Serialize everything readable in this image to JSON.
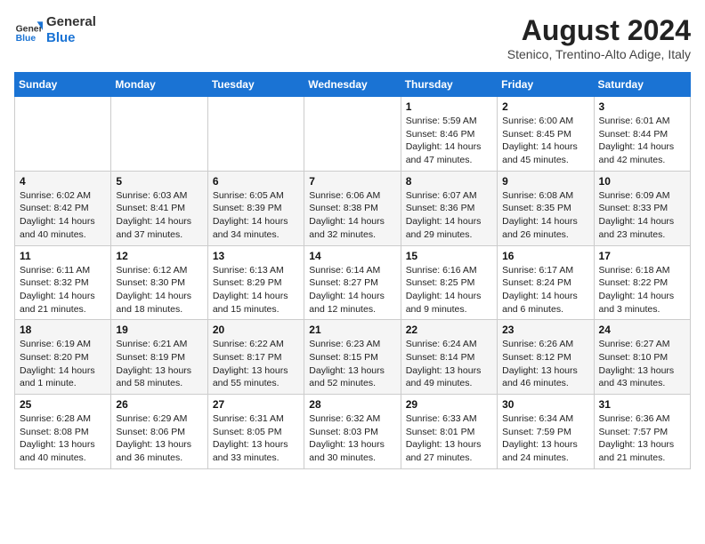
{
  "header": {
    "logo_general": "General",
    "logo_blue": "Blue",
    "month_year": "August 2024",
    "location": "Stenico, Trentino-Alto Adige, Italy"
  },
  "weekdays": [
    "Sunday",
    "Monday",
    "Tuesday",
    "Wednesday",
    "Thursday",
    "Friday",
    "Saturday"
  ],
  "weeks": [
    [
      {
        "day": "",
        "info": ""
      },
      {
        "day": "",
        "info": ""
      },
      {
        "day": "",
        "info": ""
      },
      {
        "day": "",
        "info": ""
      },
      {
        "day": "1",
        "info": "Sunrise: 5:59 AM\nSunset: 8:46 PM\nDaylight: 14 hours and 47 minutes."
      },
      {
        "day": "2",
        "info": "Sunrise: 6:00 AM\nSunset: 8:45 PM\nDaylight: 14 hours and 45 minutes."
      },
      {
        "day": "3",
        "info": "Sunrise: 6:01 AM\nSunset: 8:44 PM\nDaylight: 14 hours and 42 minutes."
      }
    ],
    [
      {
        "day": "4",
        "info": "Sunrise: 6:02 AM\nSunset: 8:42 PM\nDaylight: 14 hours and 40 minutes."
      },
      {
        "day": "5",
        "info": "Sunrise: 6:03 AM\nSunset: 8:41 PM\nDaylight: 14 hours and 37 minutes."
      },
      {
        "day": "6",
        "info": "Sunrise: 6:05 AM\nSunset: 8:39 PM\nDaylight: 14 hours and 34 minutes."
      },
      {
        "day": "7",
        "info": "Sunrise: 6:06 AM\nSunset: 8:38 PM\nDaylight: 14 hours and 32 minutes."
      },
      {
        "day": "8",
        "info": "Sunrise: 6:07 AM\nSunset: 8:36 PM\nDaylight: 14 hours and 29 minutes."
      },
      {
        "day": "9",
        "info": "Sunrise: 6:08 AM\nSunset: 8:35 PM\nDaylight: 14 hours and 26 minutes."
      },
      {
        "day": "10",
        "info": "Sunrise: 6:09 AM\nSunset: 8:33 PM\nDaylight: 14 hours and 23 minutes."
      }
    ],
    [
      {
        "day": "11",
        "info": "Sunrise: 6:11 AM\nSunset: 8:32 PM\nDaylight: 14 hours and 21 minutes."
      },
      {
        "day": "12",
        "info": "Sunrise: 6:12 AM\nSunset: 8:30 PM\nDaylight: 14 hours and 18 minutes."
      },
      {
        "day": "13",
        "info": "Sunrise: 6:13 AM\nSunset: 8:29 PM\nDaylight: 14 hours and 15 minutes."
      },
      {
        "day": "14",
        "info": "Sunrise: 6:14 AM\nSunset: 8:27 PM\nDaylight: 14 hours and 12 minutes."
      },
      {
        "day": "15",
        "info": "Sunrise: 6:16 AM\nSunset: 8:25 PM\nDaylight: 14 hours and 9 minutes."
      },
      {
        "day": "16",
        "info": "Sunrise: 6:17 AM\nSunset: 8:24 PM\nDaylight: 14 hours and 6 minutes."
      },
      {
        "day": "17",
        "info": "Sunrise: 6:18 AM\nSunset: 8:22 PM\nDaylight: 14 hours and 3 minutes."
      }
    ],
    [
      {
        "day": "18",
        "info": "Sunrise: 6:19 AM\nSunset: 8:20 PM\nDaylight: 14 hours and 1 minute."
      },
      {
        "day": "19",
        "info": "Sunrise: 6:21 AM\nSunset: 8:19 PM\nDaylight: 13 hours and 58 minutes."
      },
      {
        "day": "20",
        "info": "Sunrise: 6:22 AM\nSunset: 8:17 PM\nDaylight: 13 hours and 55 minutes."
      },
      {
        "day": "21",
        "info": "Sunrise: 6:23 AM\nSunset: 8:15 PM\nDaylight: 13 hours and 52 minutes."
      },
      {
        "day": "22",
        "info": "Sunrise: 6:24 AM\nSunset: 8:14 PM\nDaylight: 13 hours and 49 minutes."
      },
      {
        "day": "23",
        "info": "Sunrise: 6:26 AM\nSunset: 8:12 PM\nDaylight: 13 hours and 46 minutes."
      },
      {
        "day": "24",
        "info": "Sunrise: 6:27 AM\nSunset: 8:10 PM\nDaylight: 13 hours and 43 minutes."
      }
    ],
    [
      {
        "day": "25",
        "info": "Sunrise: 6:28 AM\nSunset: 8:08 PM\nDaylight: 13 hours and 40 minutes."
      },
      {
        "day": "26",
        "info": "Sunrise: 6:29 AM\nSunset: 8:06 PM\nDaylight: 13 hours and 36 minutes."
      },
      {
        "day": "27",
        "info": "Sunrise: 6:31 AM\nSunset: 8:05 PM\nDaylight: 13 hours and 33 minutes."
      },
      {
        "day": "28",
        "info": "Sunrise: 6:32 AM\nSunset: 8:03 PM\nDaylight: 13 hours and 30 minutes."
      },
      {
        "day": "29",
        "info": "Sunrise: 6:33 AM\nSunset: 8:01 PM\nDaylight: 13 hours and 27 minutes."
      },
      {
        "day": "30",
        "info": "Sunrise: 6:34 AM\nSunset: 7:59 PM\nDaylight: 13 hours and 24 minutes."
      },
      {
        "day": "31",
        "info": "Sunrise: 6:36 AM\nSunset: 7:57 PM\nDaylight: 13 hours and 21 minutes."
      }
    ]
  ]
}
